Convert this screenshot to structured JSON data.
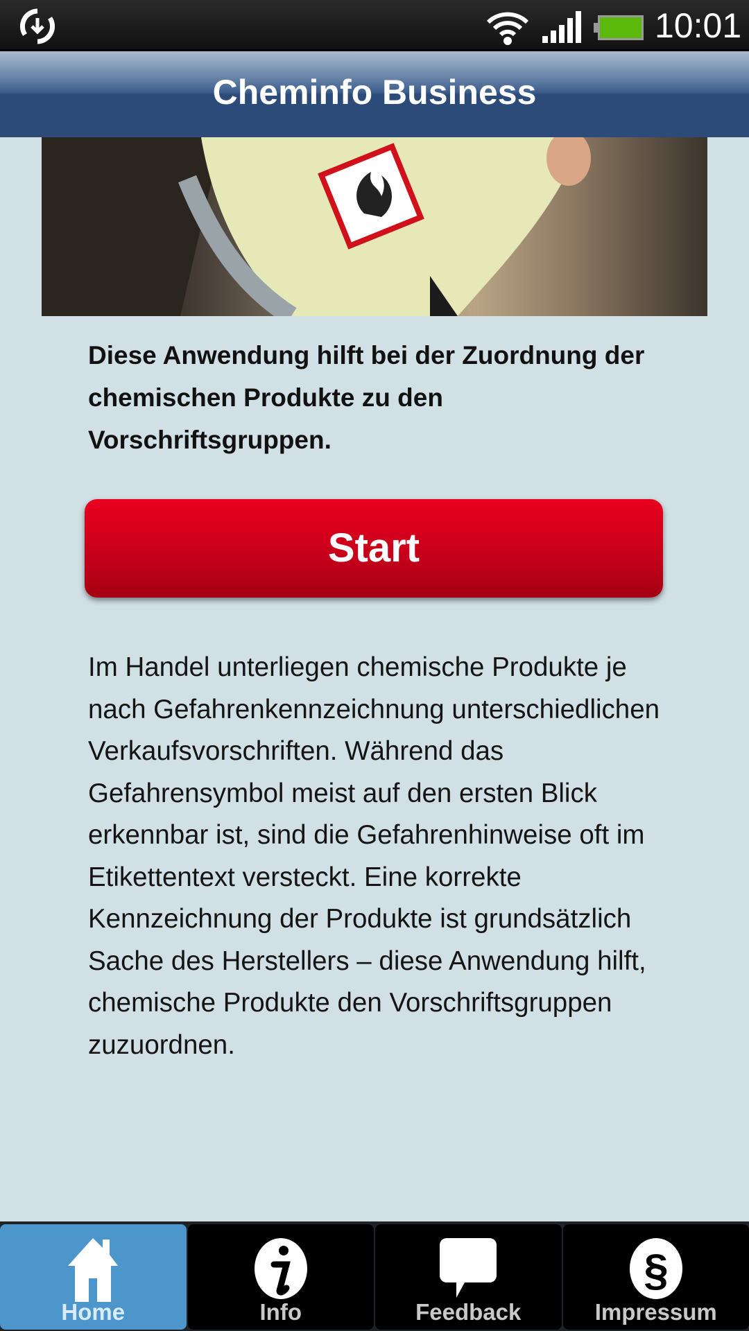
{
  "status_bar": {
    "time": "10:01",
    "icons": [
      "sync-icon",
      "wifi-icon",
      "signal-icon",
      "battery-icon"
    ],
    "battery_color": "#5ab90a"
  },
  "header": {
    "title": "Cheminfo Business"
  },
  "hero": {
    "description_icon": "flammable-hazard-pictogram"
  },
  "intro": "Diese Anwendung hilft bei der Zuordnung der chemischen Produkte zu den Vorschriftsgruppen.",
  "start_button": {
    "label": "Start",
    "color": "#d9001c"
  },
  "body": "Im Handel unterliegen chemische Produkte je nach Gefahrenkennzeichnung unterschiedlichen Verkaufsvorschriften. Während das Gefahrensymbol meist auf den ersten Blick erkennbar ist, sind die Gefahrenhinweise oft im Etikettentext versteckt. Eine korrekte Kennzeichnung der Produkte ist grundsätzlich Sache des Herstellers – diese Anwendung hilft, chemische Produkte den Vorschriftsgruppen zuzuordnen.",
  "tabs": [
    {
      "label": "Home",
      "icon": "home-icon",
      "active": true
    },
    {
      "label": "Info",
      "icon": "info-icon",
      "active": false
    },
    {
      "label": "Feedback",
      "icon": "speech-bubble-icon",
      "active": false
    },
    {
      "label": "Impressum",
      "icon": "section-sign-icon",
      "active": false
    }
  ],
  "accent": "#4d96cb"
}
